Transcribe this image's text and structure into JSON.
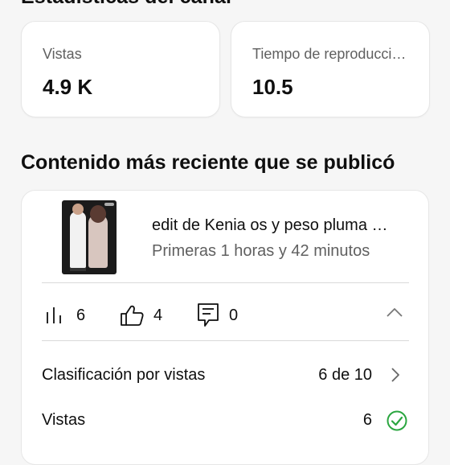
{
  "channel_stats": {
    "title": "Estadísticas del canal",
    "cards": [
      {
        "label": "Vistas",
        "value": "4.9 K"
      },
      {
        "label": "Tiempo de reproducci…",
        "value": "10.5"
      }
    ]
  },
  "recent": {
    "title": "Contenido más reciente que se publicó",
    "video_title": "edit de Kenia os y peso pluma …",
    "video_subtitle": "Primeras 1 horas y 42 minutos",
    "metrics": {
      "views": "6",
      "likes": "4",
      "comments": "0"
    },
    "rows": [
      {
        "label": "Clasificación por vistas",
        "value": "6 de 10"
      },
      {
        "label": "Vistas",
        "value": "6"
      }
    ]
  },
  "icons": {
    "views": "bar-chart-icon",
    "likes": "thumbs-up-icon",
    "comments": "comment-icon",
    "collapse": "chevron-up-icon",
    "row_more": "chevron-right-icon",
    "row_status": "check-circle-icon"
  },
  "colors": {
    "check": "#2ba640",
    "secondary_text": "#606060"
  }
}
